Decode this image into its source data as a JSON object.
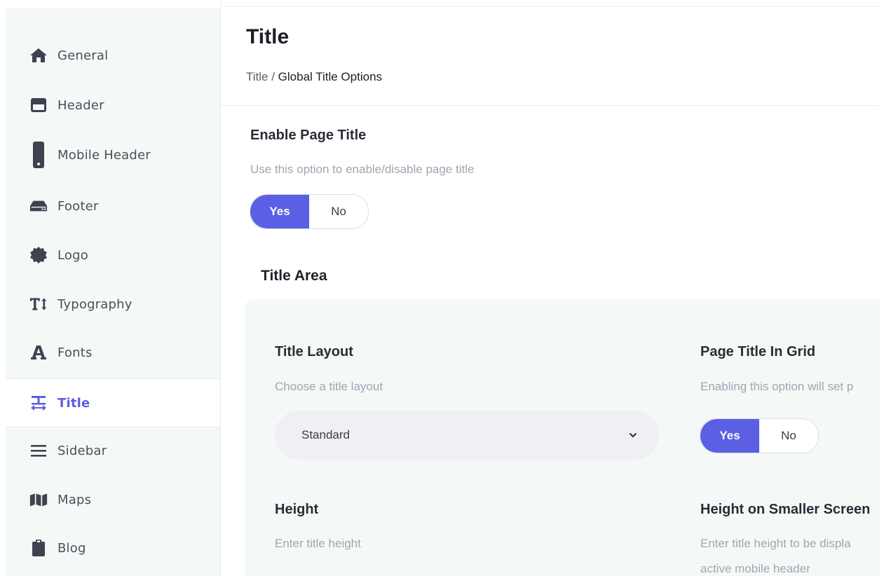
{
  "sidebar": {
    "items": [
      {
        "label": "General",
        "icon": "home-icon"
      },
      {
        "label": "Header",
        "icon": "header-icon"
      },
      {
        "label": "Mobile Header",
        "icon": "mobile-icon"
      },
      {
        "label": "Footer",
        "icon": "footer-icon"
      },
      {
        "label": "Logo",
        "icon": "badge-icon"
      },
      {
        "label": "Typography",
        "icon": "text-height-icon"
      },
      {
        "label": "Fonts",
        "icon": "font-icon"
      },
      {
        "label": "Title",
        "icon": "title-align-icon",
        "active": true
      },
      {
        "label": "Sidebar",
        "icon": "bars-icon"
      },
      {
        "label": "Maps",
        "icon": "map-icon"
      },
      {
        "label": "Blog",
        "icon": "clipboard-icon"
      }
    ]
  },
  "header": {
    "title": "Title",
    "breadcrumb_parent": "Title",
    "breadcrumb_sep": " / ",
    "breadcrumb_current": "Global Title Options"
  },
  "enable_page_title": {
    "title": "Enable Page Title",
    "description": "Use this option to enable/disable page title",
    "yes": "Yes",
    "no": "No",
    "selected": "Yes"
  },
  "title_area": {
    "label": "Title Area",
    "title_layout": {
      "title": "Title Layout",
      "description": "Choose a title layout",
      "selected_value": "Standard"
    },
    "page_title_in_grid": {
      "title": "Page Title In Grid",
      "description": "Enabling this option will set p",
      "yes": "Yes",
      "no": "No",
      "selected": "Yes"
    },
    "height": {
      "title": "Height",
      "description": "Enter title height"
    },
    "height_smaller": {
      "title": "Height on Smaller Screen",
      "description_line1": "Enter title height to be displa",
      "description_line2": "active mobile header"
    }
  },
  "colors": {
    "accent": "#5b5fe3",
    "sidebar_bg": "#f4f9f8",
    "active_text": "#5a5ee0"
  }
}
